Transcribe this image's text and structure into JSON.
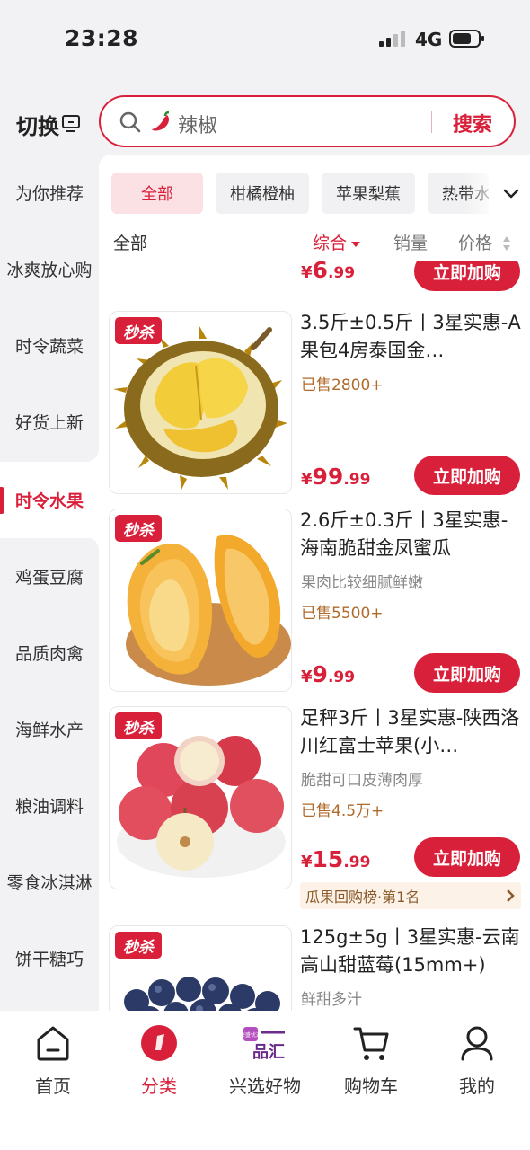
{
  "status_bar": {
    "time": "23:28",
    "network": "4G"
  },
  "top_bar": {
    "switch_label": "切换",
    "search_keyword": "辣椒",
    "search_button": "搜索"
  },
  "sidebar": {
    "items": [
      {
        "label": "为你推荐"
      },
      {
        "label": "冰爽放心购"
      },
      {
        "label": "时令蔬菜"
      },
      {
        "label": "好货上新"
      },
      {
        "label": "时令水果",
        "active": true
      },
      {
        "label": "鸡蛋豆腐"
      },
      {
        "label": "品质肉禽"
      },
      {
        "label": "海鲜水产"
      },
      {
        "label": "粮油调料"
      },
      {
        "label": "零食冰淇淋"
      },
      {
        "label": "饼干糖巧"
      }
    ]
  },
  "subcategories": {
    "chips": [
      "全部",
      "柑橘橙柚",
      "苹果梨蕉",
      "热带水"
    ],
    "active_index": 0
  },
  "sort_bar": {
    "current": "全部",
    "options": [
      "综合",
      "销量",
      "价格"
    ],
    "active": "综合"
  },
  "products": [
    {
      "title": "",
      "price_int": "6",
      "price_dec": ".99",
      "button": "立即加购"
    },
    {
      "badge": "秒杀",
      "title": "3.5斤±0.5斤丨3星实惠-A果包4房泰国金…",
      "sold": "已售2800+",
      "price_int": "99",
      "price_dec": ".99",
      "button": "立即加购",
      "image": "durian"
    },
    {
      "badge": "秒杀",
      "title": "2.6斤±0.3斤丨3星实惠-海南脆甜金凤蜜瓜",
      "desc": "果肉比较细腻鲜嫩",
      "sold": "已售5500+",
      "price_int": "9",
      "price_dec": ".99",
      "button": "立即加购",
      "image": "melon"
    },
    {
      "badge": "秒杀",
      "title": "足秤3斤丨3星实惠-陕西洛川红富士苹果(小…",
      "desc": "脆甜可口皮薄肉厚",
      "sold": "已售4.5万+",
      "price_int": "15",
      "price_dec": ".99",
      "button": "立即加购",
      "rank": "瓜果回购榜·第1名",
      "image": "apple"
    },
    {
      "badge": "秒杀",
      "title": "125g±5g丨3星实惠-云南高山甜蓝莓(15mm+)",
      "desc": "鲜甜多汁",
      "image": "blueberry"
    }
  ],
  "currency": "¥",
  "tab_bar": {
    "tabs": [
      {
        "label": "首页",
        "icon": "home-icon"
      },
      {
        "label": "分类",
        "icon": "category-icon",
        "active": true
      },
      {
        "label": "兴选好物",
        "icon": "pinhui-logo"
      },
      {
        "label": "购物车",
        "icon": "cart-icon"
      },
      {
        "label": "我的",
        "icon": "profile-icon"
      }
    ],
    "logo_text": "品汇",
    "logo_small": "兴盛优选"
  },
  "colors": {
    "accent": "#d9203a",
    "sold_text": "#b06a2a",
    "chip_active_bg": "#fbe1e4"
  }
}
